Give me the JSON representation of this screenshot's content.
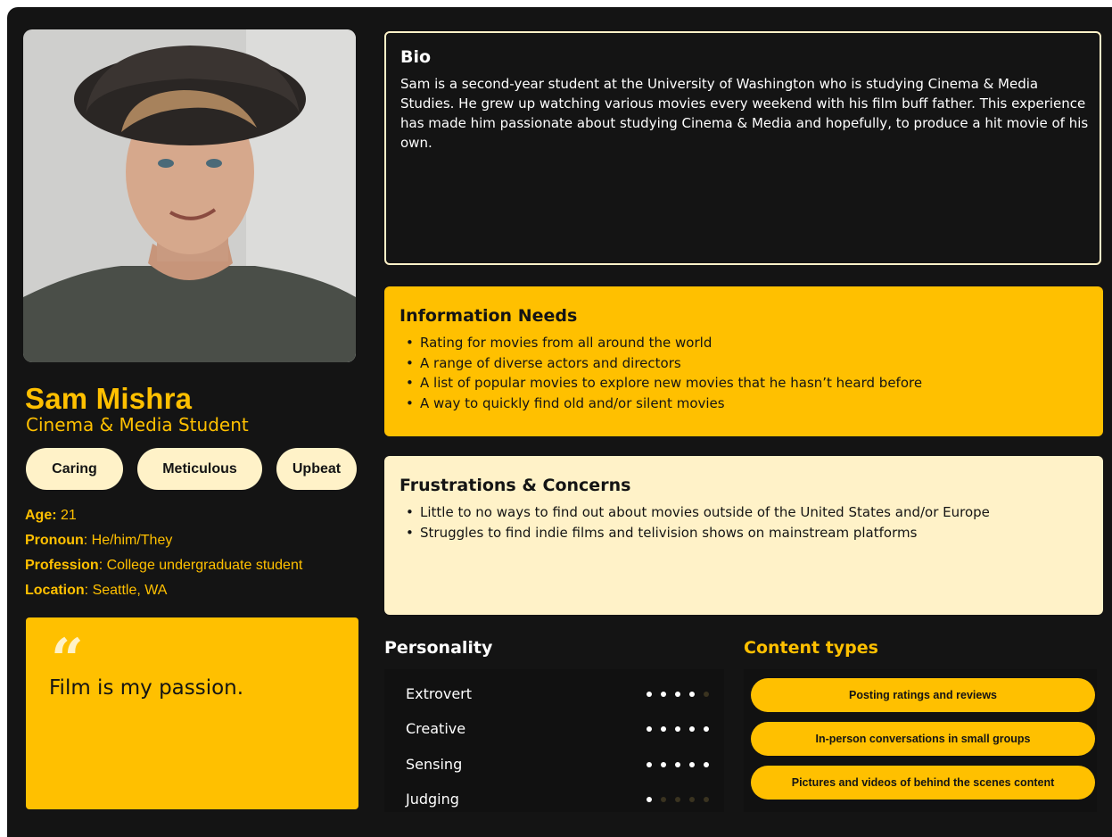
{
  "profile": {
    "name": "Sam Mishra",
    "role": "Cinema & Media Student",
    "photo_icon": "portrait-photo-icon"
  },
  "traits": [
    "Caring",
    "Meticulous",
    "Upbeat"
  ],
  "facts": [
    {
      "label": "Age:",
      "value": " 21"
    },
    {
      "label": "Pronoun",
      "value": ": He/him/They"
    },
    {
      "label": "Profession",
      "value": ": College undergraduate student"
    },
    {
      "label": "Location",
      "value": ": Seattle, WA"
    }
  ],
  "quote": {
    "mark": "“",
    "text": "Film is my passion."
  },
  "bio": {
    "title": "Bio",
    "text": "Sam is a second-year student at the University of Washington who is studying Cinema & Media Studies. He grew up watching various movies every weekend with his film buff father. This experience has made him passionate about studying Cinema & Media and hopefully, to produce a hit movie of his own."
  },
  "needs": {
    "title": "Information Needs",
    "items": [
      "Rating for movies from all around the world",
      "A range of diverse actors and directors",
      "A list of popular movies to explore new movies that he hasn’t heard before",
      "A way to quickly find old and/or silent movies"
    ]
  },
  "frustrations": {
    "title": "Frustrations & Concerns",
    "items": [
      "Little to no ways to find out about movies outside of the United States and/or Europe",
      "Struggles to find indie films and telivision shows on mainstream platforms"
    ]
  },
  "personality": {
    "title": "Personality",
    "max": 5,
    "traits": [
      {
        "label": "Extrovert",
        "level": 4
      },
      {
        "label": "Creative",
        "level": 5
      },
      {
        "label": "Sensing",
        "level": 5
      },
      {
        "label": "Judging",
        "level": 1
      }
    ]
  },
  "content_types": {
    "title": "Content types",
    "items": [
      "Posting ratings and reviews",
      "In-person conversations in small groups",
      "Pictures and videos of behind the scenes content"
    ]
  },
  "colors": {
    "background": "#141414",
    "accent": "#ffc000",
    "cream": "#fff2c8",
    "dot_off": "#3a3320"
  }
}
